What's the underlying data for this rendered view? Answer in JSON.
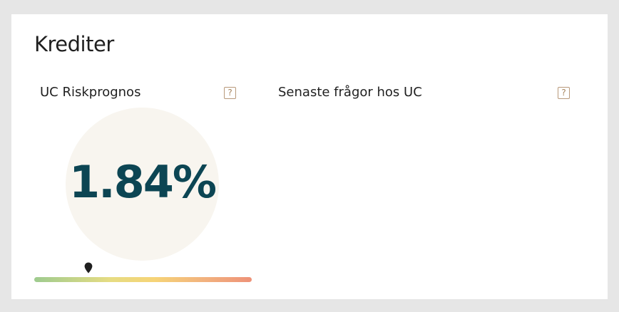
{
  "card": {
    "title": "Krediter"
  },
  "risk_panel": {
    "title": "UC Riskprognos",
    "help_icon_text": "?",
    "value": "1.84%",
    "scale_position": 0.25
  },
  "queries_panel": {
    "title": "Senaste frågor hos UC",
    "help_icon_text": "?"
  }
}
